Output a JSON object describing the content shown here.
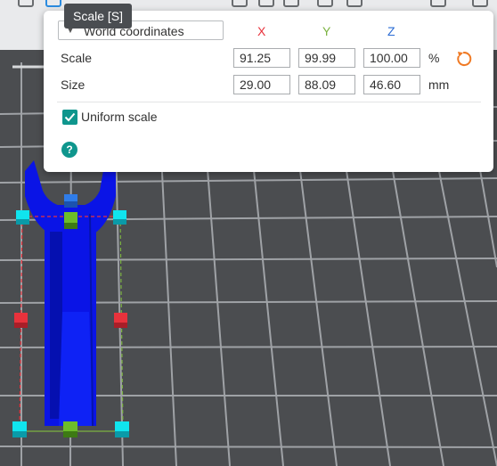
{
  "tooltip": "Scale [S]",
  "panel": {
    "coordinate_system": "World coordinates",
    "axes": {
      "x": "X",
      "y": "Y",
      "z": "Z"
    },
    "rows": [
      {
        "label": "Scale",
        "x": "91.25",
        "y": "99.99",
        "z": "100.00",
        "unit": "%"
      },
      {
        "label": "Size",
        "x": "29.00",
        "y": "88.09",
        "z": "46.60",
        "unit": "mm"
      }
    ],
    "uniform_scale": {
      "label": "Uniform scale",
      "checked": true
    },
    "help": "?"
  },
  "colors": {
    "x_axis": "#e8323c",
    "y_axis": "#7cb342",
    "z_axis": "#2b6cd4",
    "accent": "#0f968d",
    "reset": "#f07a24",
    "model": "#0a14e6"
  },
  "icons": [
    "chevron-down-icon",
    "reset-icon",
    "check-icon",
    "help-icon"
  ]
}
